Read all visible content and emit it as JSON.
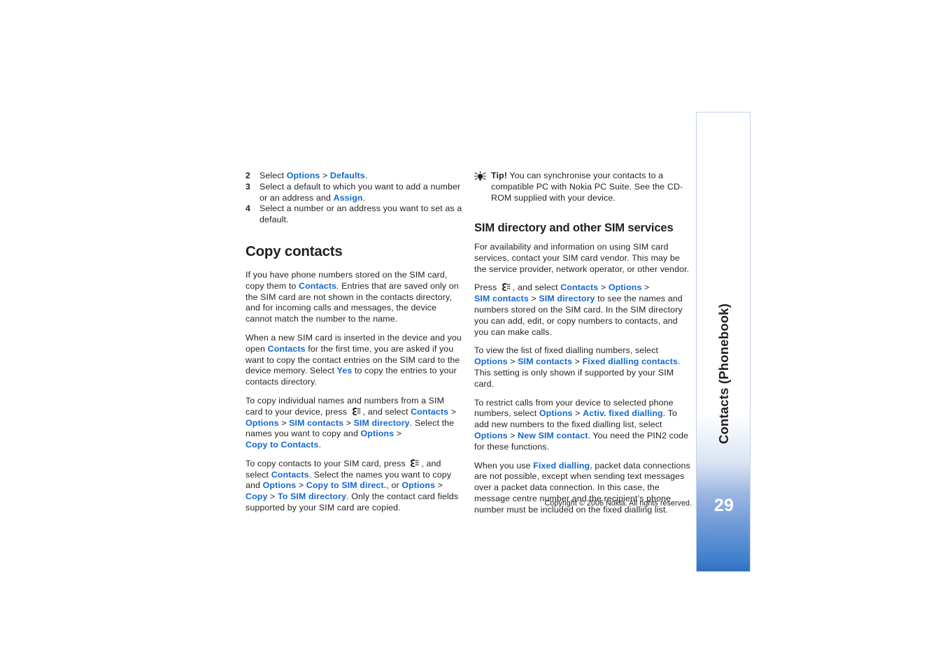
{
  "document": {
    "chapter_label": "Contacts (Phonebook)",
    "page_number": "29",
    "copyright": "Copyright © 2006 Nokia. All rights reserved."
  },
  "left_column": {
    "steps": [
      {
        "num": "2",
        "parts": [
          {
            "t": "Select ",
            "k": "plain"
          },
          {
            "t": "Options",
            "k": "link"
          },
          {
            "t": " > ",
            "k": "gt"
          },
          {
            "t": "Defaults",
            "k": "link"
          },
          {
            "t": ".",
            "k": "plain"
          }
        ]
      },
      {
        "num": "3",
        "parts": [
          {
            "t": "Select a default to which you want to add a number or an address and ",
            "k": "plain"
          },
          {
            "t": "Assign",
            "k": "link"
          },
          {
            "t": ".",
            "k": "plain"
          }
        ]
      },
      {
        "num": "4",
        "parts": [
          {
            "t": "Select a number or an address you want to set as a default.",
            "k": "plain"
          }
        ]
      }
    ],
    "heading": "Copy contacts",
    "paragraphs": [
      {
        "parts": [
          {
            "t": "If you have phone numbers stored on the SIM card, copy them to ",
            "k": "plain"
          },
          {
            "t": "Contacts",
            "k": "link"
          },
          {
            "t": ". Entries that are saved only on the SIM card are not shown in the contacts directory, and for incoming calls and messages, the device cannot match the number to the name.",
            "k": "plain"
          }
        ]
      },
      {
        "parts": [
          {
            "t": "When a new SIM card is inserted in the device and you open ",
            "k": "plain"
          },
          {
            "t": "Contacts",
            "k": "link"
          },
          {
            "t": " for the first time, you are asked if you want to copy the contact entries on the SIM card to the device memory. Select ",
            "k": "plain"
          },
          {
            "t": "Yes",
            "k": "link"
          },
          {
            "t": " to copy the entries to your contacts directory.",
            "k": "plain"
          }
        ]
      },
      {
        "parts": [
          {
            "t": "To copy individual names and numbers from a SIM card to your device, press ",
            "k": "plain"
          },
          {
            "t": "menu-key-icon",
            "k": "keyicon"
          },
          {
            "t": ", and select ",
            "k": "plain"
          },
          {
            "t": "Contacts",
            "k": "link"
          },
          {
            "t": " > ",
            "k": "gt"
          },
          {
            "t": "Options",
            "k": "link"
          },
          {
            "t": " > ",
            "k": "gt"
          },
          {
            "t": "SIM contacts",
            "k": "link"
          },
          {
            "t": " > ",
            "k": "gt"
          },
          {
            "t": "SIM directory",
            "k": "link"
          },
          {
            "t": ". Select the names you want to copy and ",
            "k": "plain"
          },
          {
            "t": "Options",
            "k": "link"
          },
          {
            "t": " > ",
            "k": "gt"
          },
          {
            "t": "Copy to Contacts",
            "k": "link"
          },
          {
            "t": ".",
            "k": "plain"
          }
        ]
      },
      {
        "parts": [
          {
            "t": "To copy contacts to your SIM card, press ",
            "k": "plain"
          },
          {
            "t": "menu-key-icon",
            "k": "keyicon"
          },
          {
            "t": ", and select ",
            "k": "plain"
          },
          {
            "t": "Contacts",
            "k": "link"
          },
          {
            "t": ". Select the names you want to copy and ",
            "k": "plain"
          },
          {
            "t": "Options",
            "k": "link"
          },
          {
            "t": " > ",
            "k": "gt"
          },
          {
            "t": "Copy to SIM direct.",
            "k": "link"
          },
          {
            "t": ", or ",
            "k": "plain"
          },
          {
            "t": "Options",
            "k": "link"
          },
          {
            "t": " > ",
            "k": "gt"
          },
          {
            "t": "Copy",
            "k": "link"
          },
          {
            "t": " > ",
            "k": "gt"
          },
          {
            "t": "To SIM directory",
            "k": "link"
          },
          {
            "t": ". Only the contact card fields supported by your SIM card are copied.",
            "k": "plain"
          }
        ]
      }
    ]
  },
  "right_column": {
    "tip": {
      "label": "Tip!",
      "text": " You can synchronise your contacts to a compatible PC with Nokia PC Suite. See the CD-ROM supplied with your device."
    },
    "heading": "SIM directory and other SIM services",
    "paragraphs": [
      {
        "parts": [
          {
            "t": "For availability and information on using SIM card services, contact your SIM card vendor. This may be the service provider, network operator, or other vendor.",
            "k": "plain"
          }
        ]
      },
      {
        "parts": [
          {
            "t": "Press ",
            "k": "plain"
          },
          {
            "t": "menu-key-icon",
            "k": "keyicon"
          },
          {
            "t": ", and select ",
            "k": "plain"
          },
          {
            "t": "Contacts",
            "k": "link"
          },
          {
            "t": " > ",
            "k": "gt"
          },
          {
            "t": "Options",
            "k": "link"
          },
          {
            "t": " > ",
            "k": "gt"
          },
          {
            "t": "SIM contacts",
            "k": "link"
          },
          {
            "t": " > ",
            "k": "gt"
          },
          {
            "t": "SIM directory",
            "k": "link"
          },
          {
            "t": " to see the names and numbers stored on the SIM card. In the SIM directory you can add, edit, or copy numbers to contacts, and you can make calls.",
            "k": "plain"
          }
        ]
      },
      {
        "parts": [
          {
            "t": "To view the list of fixed dialling numbers, select ",
            "k": "plain"
          },
          {
            "t": "Options",
            "k": "link"
          },
          {
            "t": " > ",
            "k": "gt"
          },
          {
            "t": "SIM contacts",
            "k": "link"
          },
          {
            "t": " > ",
            "k": "gt"
          },
          {
            "t": "Fixed dialling contacts",
            "k": "link"
          },
          {
            "t": ". This setting is only shown if supported by your SIM card.",
            "k": "plain"
          }
        ]
      },
      {
        "parts": [
          {
            "t": "To restrict calls from your device to selected phone numbers, select ",
            "k": "plain"
          },
          {
            "t": "Options",
            "k": "link"
          },
          {
            "t": " > ",
            "k": "gt"
          },
          {
            "t": "Activ. fixed dialling",
            "k": "link"
          },
          {
            "t": ". To add new numbers to the fixed dialling list, select ",
            "k": "plain"
          },
          {
            "t": "Options",
            "k": "link"
          },
          {
            "t": " > ",
            "k": "gt"
          },
          {
            "t": "New SIM contact",
            "k": "link"
          },
          {
            "t": ". You need the PIN2 code for these functions.",
            "k": "plain"
          }
        ]
      },
      {
        "parts": [
          {
            "t": "When you use ",
            "k": "plain"
          },
          {
            "t": "Fixed dialling",
            "k": "link"
          },
          {
            "t": ", packet data connections are not possible, except when sending text messages over a packet data connection. In this case, the message centre number and the recipient’s phone number must be included on the fixed dialling list.",
            "k": "plain"
          }
        ]
      }
    ]
  }
}
